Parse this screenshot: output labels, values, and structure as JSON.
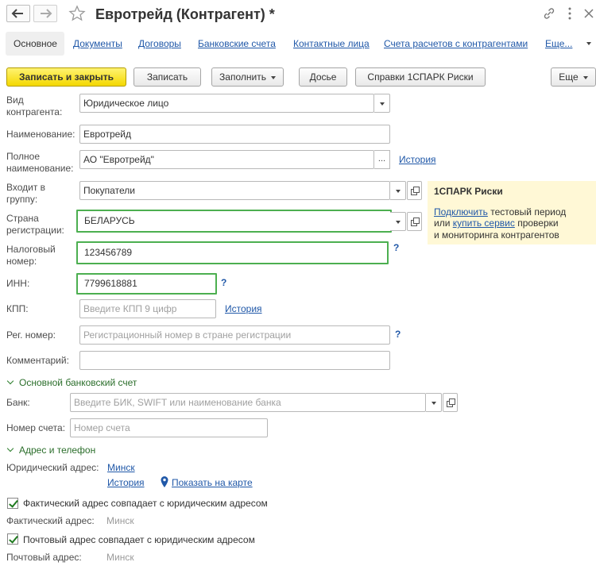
{
  "window": {
    "title": "Евротрейд (Контрагент) *"
  },
  "tabs": [
    "Основное",
    "Документы",
    "Договоры",
    "Банковские счета",
    "Контактные лица",
    "Счета расчетов с контрагентами",
    "Еще..."
  ],
  "toolbar": {
    "save_close": "Записать и закрыть",
    "save": "Записать",
    "fill": "Заполнить",
    "dossier": "Досье",
    "spark": "Справки 1СПАРК Риски",
    "more": "Еще"
  },
  "form": {
    "kind_label_1": "Вид",
    "kind_label_2": "контрагента:",
    "kind_value": "Юридическое лицо",
    "name_label": "Наименование:",
    "name_value": "Евротрейд",
    "full_label_1": "Полное",
    "full_label_2": "наименование:",
    "full_value": "АО \"Евротрейд\"",
    "full_dots": "...",
    "history": "История",
    "group_label_1": "Входит в",
    "group_label_2": "группу:",
    "group_value": "Покупатели",
    "country_label_1": "Страна",
    "country_label_2": "регистрации:",
    "country_value": "БЕЛАРУСЬ",
    "tax_label_1": "Налоговый",
    "tax_label_2": "номер:",
    "tax_value": "123456789",
    "inn_label": "ИНН:",
    "inn_value": "7799618881",
    "kpp_label": "КПП:",
    "kpp_placeholder": "Введите КПП 9 цифр",
    "reg_label": "Рег. номер:",
    "reg_placeholder": "Регистрационный номер в стране регистрации",
    "comment_label": "Комментарий:",
    "help": "?"
  },
  "spark_panel": {
    "title": "1СПАРК Риски",
    "connect": "Подключить",
    "line1_rest": "тестовый период",
    "line2_pre": "или",
    "buy": "купить сервис",
    "line2_rest": "проверки",
    "line3": "и мониторинга контрагентов"
  },
  "bank_section": {
    "title": "Основной банковский счет",
    "bank_label": "Банк:",
    "bank_placeholder": "Введите БИК, SWIFT или наименование банка",
    "account_label": "Номер счета:",
    "account_placeholder": "Номер счета"
  },
  "address_section": {
    "title": "Адрес и телефон",
    "legal_label": "Юридический адрес:",
    "legal_value": "Минск",
    "history": "История",
    "map": "Показать на карте",
    "actual_same": "Фактический адрес совпадает с юридическим адресом",
    "actual_label": "Фактический адрес:",
    "actual_value": "Минск",
    "postal_same": "Почтовый адрес совпадает с юридическим адресом",
    "postal_label": "Почтовый адрес:",
    "postal_value": "Минск"
  },
  "colors": {
    "primary_button": "#f4d800",
    "highlight": "#4caf50",
    "link": "#2058a8",
    "section": "#2b6e2b",
    "panel": "#fff8d6"
  }
}
